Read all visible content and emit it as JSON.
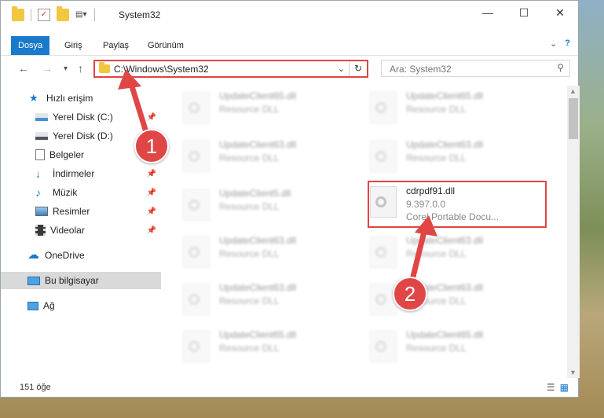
{
  "window": {
    "title": "System32",
    "minimize_icon": "minimize-icon",
    "maximize_icon": "maximize-icon",
    "close_icon": "close-icon"
  },
  "ribbon": {
    "tabs": [
      {
        "label": "Dosya",
        "active": true
      },
      {
        "label": "Giriş",
        "active": false
      },
      {
        "label": "Paylaş",
        "active": false
      },
      {
        "label": "Görünüm",
        "active": false
      }
    ]
  },
  "nav": {
    "address_path": "C:\\Windows\\System32",
    "search_placeholder": "Ara: System32"
  },
  "sidebar": {
    "items": [
      {
        "label": "Hızlı erişim",
        "icon": "star-icon",
        "pinned": false
      },
      {
        "label": "Yerel Disk (C:)",
        "icon": "drive-icon",
        "pinned": true
      },
      {
        "label": "Yerel Disk (D:)",
        "icon": "drive-icon",
        "pinned": true
      },
      {
        "label": "Belgeler",
        "icon": "document-icon",
        "pinned": true
      },
      {
        "label": "İndirmeler",
        "icon": "download-icon",
        "pinned": true
      },
      {
        "label": "Müzik",
        "icon": "music-icon",
        "pinned": true
      },
      {
        "label": "Resimler",
        "icon": "image-icon",
        "pinned": true
      },
      {
        "label": "Videolar",
        "icon": "video-icon",
        "pinned": true
      },
      {
        "label": "OneDrive",
        "icon": "cloud-icon",
        "pinned": false
      },
      {
        "label": "Bu bilgisayar",
        "icon": "computer-icon",
        "pinned": false,
        "selected": true
      },
      {
        "label": "Ağ",
        "icon": "network-icon",
        "pinned": false
      }
    ]
  },
  "files": {
    "left": [
      {
        "name": "UpdateClient65.dll",
        "desc": "Resource DLL"
      },
      {
        "name": "UpdateClient63.dll",
        "desc": "Resource DLL"
      },
      {
        "name": "UpdateClient5.dll",
        "desc": "Resource DLL"
      },
      {
        "name": "UpdateClient63.dll",
        "desc": "Resource DLL"
      },
      {
        "name": "UpdateClient63.dll",
        "desc": "Resource DLL"
      },
      {
        "name": "UpdateClient65.dll",
        "desc": "Resource DLL"
      }
    ],
    "right": [
      {
        "name": "UpdateClient65.dll",
        "desc": "Resource DLL"
      },
      {
        "name": "UpdateClient63.dll",
        "desc": "Resource DLL"
      },
      {
        "name": "cdrpdf91.dll",
        "version": "9.397.0.0",
        "desc": "Corel Portable Docu...",
        "highlighted": true
      },
      {
        "name": "UpdateClient63.dll",
        "desc": "Resource DLL"
      },
      {
        "name": "UpdateClient63.dll",
        "desc": "Resource DLL"
      },
      {
        "name": "UpdateClient65.dll",
        "desc": "Resource DLL"
      }
    ]
  },
  "status": {
    "item_count": "151 öğe"
  },
  "callouts": {
    "one": "1",
    "two": "2"
  },
  "colors": {
    "accent": "#1979ca",
    "highlight": "#e04444"
  }
}
